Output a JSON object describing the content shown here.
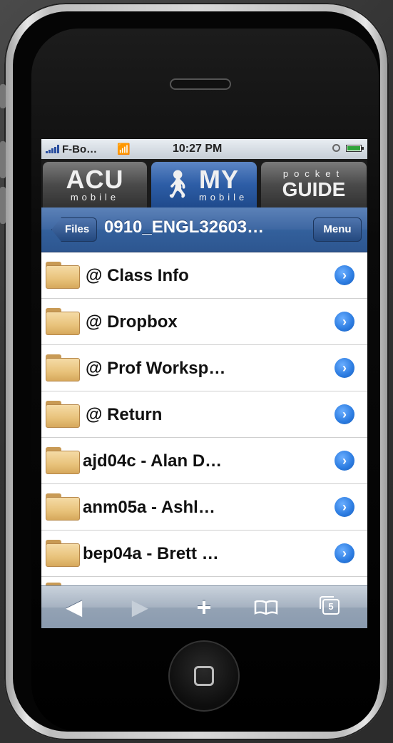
{
  "status_bar": {
    "carrier": "F-Bo…",
    "time": "10:27 PM"
  },
  "tabs": [
    {
      "big": "ACU",
      "small": "mobile"
    },
    {
      "big": "MY",
      "small": "mobile"
    },
    {
      "top": "pocket",
      "big": "GUIDE"
    }
  ],
  "nav": {
    "back_label": "Files",
    "title": "0910_ENGL32603…",
    "menu_label": "Menu"
  },
  "list": {
    "items": [
      {
        "label": "@ Class Info"
      },
      {
        "label": "@ Dropbox"
      },
      {
        "label": "@ Prof Worksp…"
      },
      {
        "label": "@ Return"
      },
      {
        "label": "ajd04c - Alan D…"
      },
      {
        "label": "anm05a - Ashl…"
      },
      {
        "label": "bep04a - Brett …"
      }
    ]
  },
  "toolbar": {
    "back_icon": "◀",
    "forward_icon": "▶",
    "add_icon": "+",
    "pages_count": "5"
  },
  "colors": {
    "accent": "#2d5da6",
    "disclosure": "#2b7be0",
    "folder": "#e8c27a"
  }
}
